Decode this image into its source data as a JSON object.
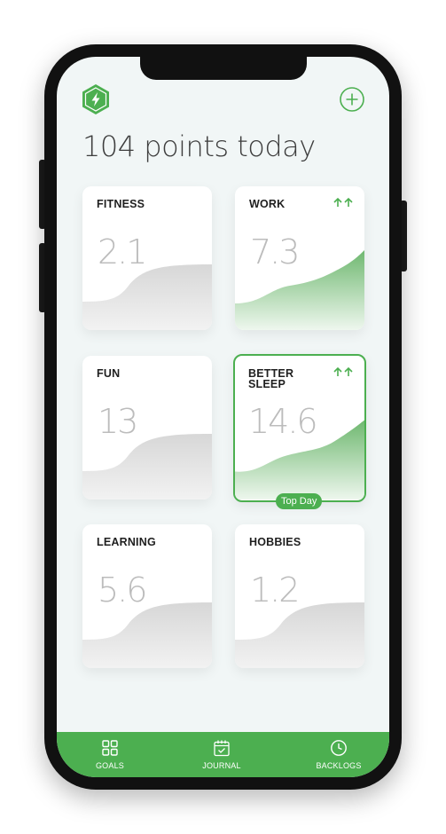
{
  "header": {
    "points_text": "104 points today",
    "logo_icon": "bolt-hexagon-icon",
    "add_icon": "plus-circle-icon"
  },
  "cards": [
    {
      "title": "FITNESS",
      "value": "2.1",
      "trend": false,
      "highlight": false
    },
    {
      "title": "WORK",
      "value": "7.3",
      "trend": true,
      "trend_icon": "double-up-arrow-icon",
      "highlight": false
    },
    {
      "title": "FUN",
      "value": "13",
      "trend": false,
      "highlight": false
    },
    {
      "title": "BETTER SLEEP",
      "value": "14.6",
      "trend": true,
      "trend_icon": "double-up-arrow-icon",
      "highlight": true,
      "badge": "Top Day"
    },
    {
      "title": "LEARNING",
      "value": "5.6",
      "trend": false,
      "highlight": false
    },
    {
      "title": "HOBBIES",
      "value": "1.2",
      "trend": false,
      "highlight": false
    }
  ],
  "bottom_nav": [
    {
      "label": "GOALS",
      "icon": "grid-icon"
    },
    {
      "label": "JOURNAL",
      "icon": "calendar-check-icon"
    },
    {
      "label": "BACKLOGS",
      "icon": "clock-icon"
    }
  ],
  "colors": {
    "accent": "#4caf50",
    "background": "#f1f6f6",
    "value_text": "#bcbcbc"
  }
}
